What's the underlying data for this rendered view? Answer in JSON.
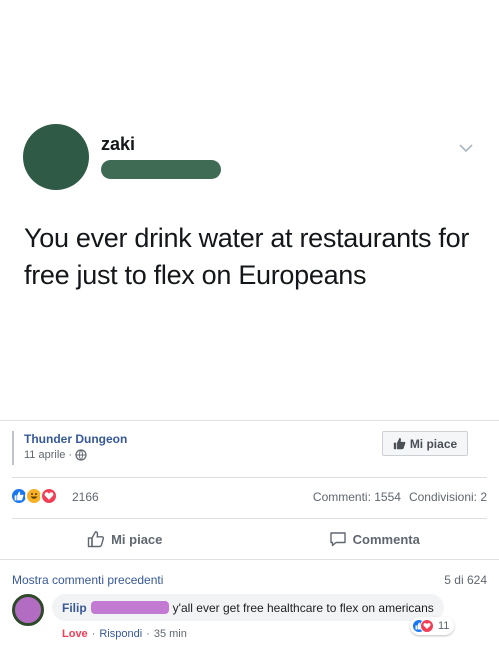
{
  "tweet": {
    "author_name": "zaki",
    "text": "You ever drink water at restaurants for free just to flex on Europeans"
  },
  "post": {
    "page_name": "Thunder Dungeon",
    "date": "11 aprile",
    "separator": "·",
    "like_page_label": "Mi piace"
  },
  "stats": {
    "reactions_count": "2166",
    "comments_label": "Commenti: 1554",
    "shares_label": "Condivisioni: 2"
  },
  "actions": {
    "like_label": "Mi piace",
    "comment_label": "Commenta"
  },
  "comments": {
    "show_previous_label": "Mostra commenti precedenti",
    "pager": "5 di 624",
    "items": [
      {
        "author": "Filip",
        "text": "y'all ever get free healthcare to flex on americans",
        "reaction_count": "11",
        "reaction_label": "Love",
        "reply_label": "Rispondi",
        "time": "35 min",
        "separator": "·"
      }
    ]
  },
  "colors": {
    "link_blue": "#365899",
    "like_blue": "#1877f2",
    "love_red": "#f33e58",
    "haha_yellow": "#f7b125",
    "avatar_green": "#2f5a45",
    "redaction_purple": "#c37ad3"
  },
  "icons": {
    "tweet_menu": "chevron-down-icon",
    "page_like": "thumbs-up-icon",
    "privacy": "globe-icon",
    "like_action": "thumbs-up-outline-icon",
    "comment_action": "speech-bubble-icon"
  }
}
